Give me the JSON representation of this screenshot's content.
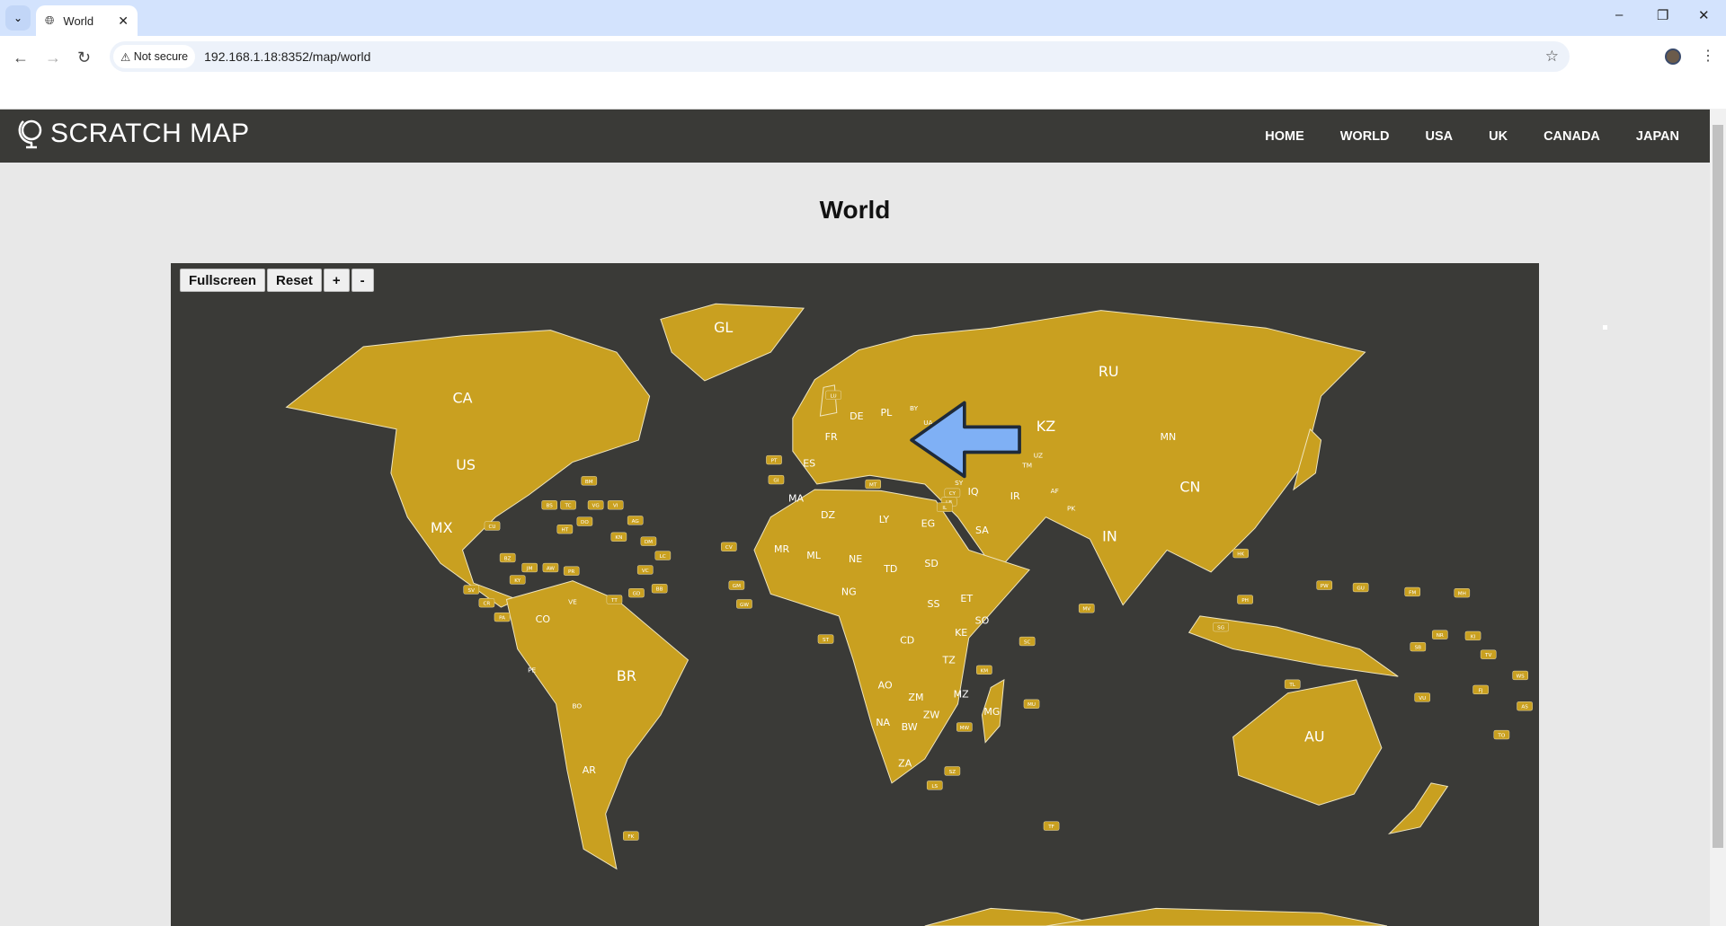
{
  "browser": {
    "tab_title": "World",
    "not_secure": "Not secure",
    "url": "192.168.1.18:8352/map/world"
  },
  "header": {
    "logo": "SCRATCH MAP",
    "nav": [
      "HOME",
      "WORLD",
      "USA",
      "UK",
      "CANADA",
      "JAPAN"
    ]
  },
  "page": {
    "title": "World"
  },
  "map": {
    "controls": {
      "fullscreen": "Fullscreen",
      "reset": "Reset",
      "zoom_in": "+",
      "zoom_out": "-"
    },
    "colors": {
      "land": "#c9a020",
      "border": "#f0e6c0",
      "sea": "#3a3a37",
      "arrow": "#7fb0f5"
    },
    "large_labels": [
      "CA",
      "US",
      "MX",
      "GL",
      "RU",
      "KZ",
      "MN",
      "CN",
      "IN",
      "IR",
      "SA",
      "BR",
      "AR",
      "CO",
      "AU",
      "CD",
      "DZ",
      "LY",
      "EG",
      "SD",
      "TD",
      "NE",
      "ML",
      "MR",
      "NG",
      "ET",
      "SS",
      "KE",
      "TZ",
      "AO",
      "ZM",
      "ZW",
      "MZ",
      "NA",
      "BW",
      "ZA",
      "MG",
      "FR",
      "ES",
      "DE",
      "PL",
      "MA",
      "SO",
      "UZ",
      "TM",
      "AF",
      "PK",
      "PE",
      "BO",
      "VE",
      "TR",
      "SY",
      "IQ",
      "UA",
      "BY"
    ],
    "tag_labels": [
      "BM",
      "BS",
      "TC",
      "VG",
      "VI",
      "CU",
      "DO",
      "HT",
      "AG",
      "KN",
      "DM",
      "LC",
      "VC",
      "BB",
      "GD",
      "TT",
      "PR",
      "AW",
      "JM",
      "KY",
      "BZ",
      "SV",
      "CR",
      "PA",
      "CV",
      "GM",
      "GW",
      "ST",
      "LU",
      "PT",
      "GI",
      "MT",
      "CY",
      "LB",
      "IL",
      "SC",
      "KM",
      "MU",
      "MW",
      "LS",
      "SZ",
      "MV",
      "TF",
      "FK",
      "HK",
      "PH",
      "SG",
      "TL",
      "FM",
      "GU",
      "MH",
      "NR",
      "KI",
      "TV",
      "SB",
      "VU",
      "FJ",
      "WS",
      "AS",
      "TO",
      "PW"
    ]
  }
}
